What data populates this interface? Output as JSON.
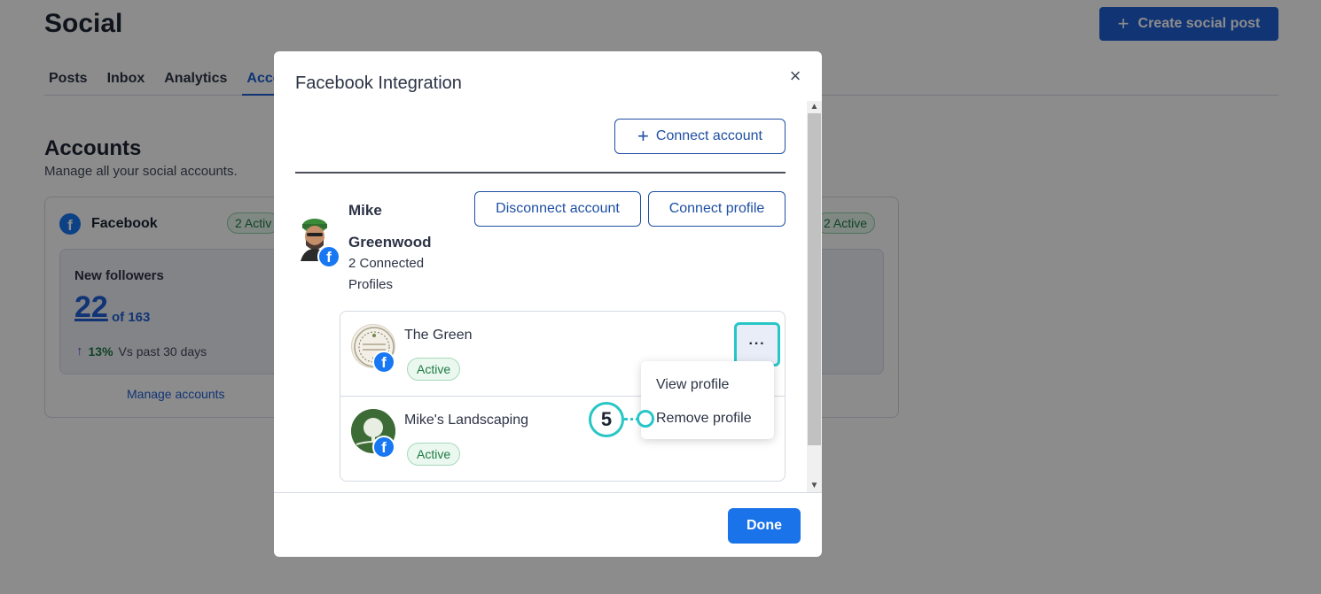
{
  "page": {
    "title": "Social",
    "create_button": "Create social post",
    "tabs": [
      "Posts",
      "Inbox",
      "Analytics",
      "Acco"
    ],
    "accounts_title": "Accounts",
    "accounts_subtitle": "Manage all your social accounts.",
    "facebook_card": {
      "name": "Facebook",
      "badge": "2 Activ",
      "followers_label": "New followers",
      "followers_value": "22",
      "followers_of": "of 163",
      "trend_pct": "13%",
      "trend_text": "Vs past 30 days",
      "manage_link": "Manage accounts"
    },
    "right_card_badge": "2 Active"
  },
  "modal": {
    "title": "Facebook Integration",
    "connect_account": "Connect account",
    "disconnect_account": "Disconnect account",
    "connect_profile": "Connect profile",
    "account_name": "Mike Greenwood",
    "connected_profiles": "2 Connected Profiles",
    "profiles": [
      {
        "name": "The Green",
        "status": "Active"
      },
      {
        "name": "Mike's Landscaping",
        "status": "Active"
      }
    ],
    "more_button": "···",
    "menu": {
      "view_profile": "View profile",
      "remove_profile": "Remove profile"
    },
    "callout_step": "5",
    "done": "Done"
  },
  "colors": {
    "primary": "#1f5fd6",
    "facebook": "#1877f2",
    "callout": "#28c6c6",
    "active_badge": "#1f7a43"
  }
}
